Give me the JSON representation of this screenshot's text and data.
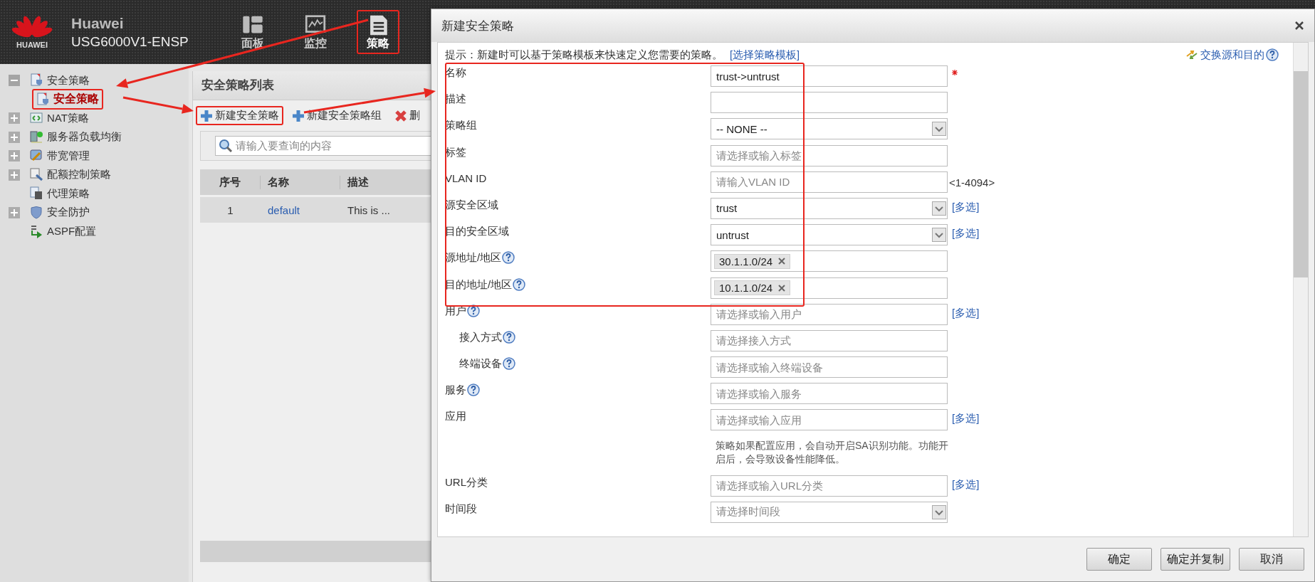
{
  "header": {
    "logo_text": "HUAWEI",
    "brand": "Huawei",
    "device": "USG6000V1-ENSP",
    "nav": [
      {
        "label": "面板",
        "kind": "dashboard",
        "selected": false,
        "annotated": false
      },
      {
        "label": "监控",
        "kind": "monitor",
        "selected": false,
        "annotated": false
      },
      {
        "label": "策略",
        "kind": "policy",
        "selected": true,
        "annotated": true
      }
    ]
  },
  "sidebar": {
    "items": [
      {
        "label": "安全策略",
        "kind": "group",
        "expanded": true,
        "selected": false,
        "annotated": false,
        "children": [
          {
            "label": "安全策略",
            "selected": true,
            "annotated": true
          }
        ]
      },
      {
        "label": "NAT策略",
        "kind": "group",
        "expanded": false,
        "selected": false,
        "annotated": false
      },
      {
        "label": "服务器负载均衡",
        "kind": "group",
        "expanded": false,
        "selected": false,
        "annotated": false
      },
      {
        "label": "带宽管理",
        "kind": "group",
        "expanded": false,
        "selected": false,
        "annotated": false
      },
      {
        "label": "配额控制策略",
        "kind": "group",
        "expanded": false,
        "selected": false,
        "annotated": false
      },
      {
        "label": "代理策略",
        "kind": "leaf",
        "selected": false,
        "annotated": false
      },
      {
        "label": "安全防护",
        "kind": "group",
        "expanded": false,
        "selected": false,
        "annotated": false
      },
      {
        "label": "ASPF配置",
        "kind": "leaf",
        "selected": false,
        "annotated": false
      }
    ]
  },
  "policy_list": {
    "title": "安全策略列表",
    "toolbar": [
      {
        "label": "新建安全策略",
        "kind": "add",
        "annotated": true
      },
      {
        "label": "新建安全策略组",
        "kind": "add",
        "annotated": false
      },
      {
        "label": "删",
        "kind": "delete",
        "annotated": false
      }
    ],
    "search": {
      "placeholder": "请输入要查询的内容"
    },
    "table": {
      "columns": [
        "序号",
        "名称",
        "描述"
      ],
      "rows": [
        {
          "cells": [
            "1",
            "default",
            "This is ..."
          ]
        }
      ]
    }
  },
  "dialog": {
    "title": "新建安全策略",
    "hint": "提示：新建时可以基于策略模板来快速定义您需要的策略。",
    "hint_link": "[选择策略模板]",
    "swap_link": "交换源和目的",
    "highlighted_fields": [
      {
        "label": "名称",
        "kind": "text",
        "value": "trust->untrust",
        "required": true,
        "help": false
      },
      {
        "label": "描述",
        "kind": "text",
        "required": false,
        "help": false
      },
      {
        "label": "策略组",
        "kind": "select",
        "value": "-- NONE --",
        "required": false,
        "help": false
      },
      {
        "label": "标签",
        "kind": "text",
        "placeholder": "请选择或输入标签",
        "required": false,
        "help": false
      },
      {
        "label": "VLAN ID",
        "kind": "text",
        "placeholder": "请输入VLAN ID",
        "suffix": "<1-4094>",
        "required": false,
        "help": false
      },
      {
        "label": "源安全区域",
        "kind": "select",
        "value": "trust",
        "link": "[多选]",
        "required": false,
        "help": false
      },
      {
        "label": "目的安全区域",
        "kind": "select",
        "value": "untrust",
        "link": "[多选]",
        "required": false,
        "help": false
      },
      {
        "label": "源地址/地区",
        "kind": "tags",
        "tags": [
          "30.1.1.0/24"
        ],
        "required": false,
        "help": true
      },
      {
        "label": "目的地址/地区",
        "kind": "tags",
        "tags": [
          "10.1.1.0/24"
        ],
        "required": false,
        "help": true
      }
    ],
    "fields": [
      {
        "label": "用户",
        "kind": "text",
        "placeholder": "请选择或输入用户",
        "link": "[多选]",
        "required": false,
        "help": true,
        "children": [
          {
            "label": "接入方式",
            "kind": "text",
            "placeholder": "请选择接入方式",
            "required": false,
            "help": true
          },
          {
            "label": "终端设备",
            "kind": "text",
            "placeholder": "请选择或输入终端设备",
            "required": false,
            "help": true
          }
        ]
      },
      {
        "label": "服务",
        "kind": "text",
        "placeholder": "请选择或输入服务",
        "required": false,
        "help": true
      },
      {
        "label": "应用",
        "kind": "text",
        "placeholder": "请选择或输入应用",
        "link": "[多选]",
        "note": "策略如果配置应用，会自动开启SA识别功能。功能开启后，会导致设备性能降低。",
        "required": false,
        "help": false
      },
      {
        "label": "URL分类",
        "kind": "text",
        "placeholder": "请选择或输入URL分类",
        "link": "[多选]",
        "required": false,
        "help": false
      },
      {
        "label": "时间段",
        "kind": "select",
        "placeholder": "请选择时间段",
        "required": false,
        "help": false
      }
    ],
    "buttons": [
      "确定",
      "确定并复制",
      "取消"
    ]
  }
}
